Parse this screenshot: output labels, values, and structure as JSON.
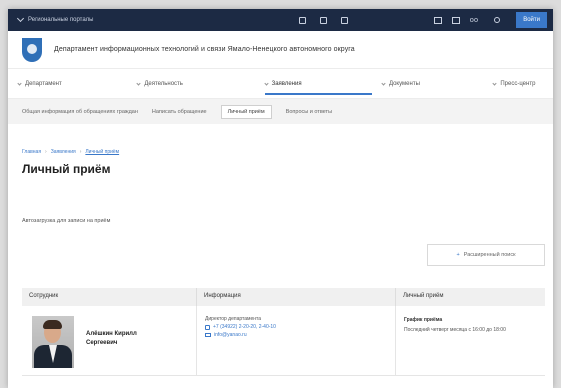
{
  "topbar": {
    "region_label": "Региональные порталы",
    "login_label": "Войти"
  },
  "header": {
    "title": "Департамент информационных технологий и связи Ямало-Ненецкого автономного округа"
  },
  "main_nav": [
    {
      "label": "Департамент"
    },
    {
      "label": "Деятельность"
    },
    {
      "label": "Заявления"
    },
    {
      "label": "Документы"
    },
    {
      "label": "Пресс-центр"
    }
  ],
  "sub_nav": [
    {
      "label": "Общая информация об обращениях граждан"
    },
    {
      "label": "Написать обращение"
    },
    {
      "label": "Личный приём"
    },
    {
      "label": "Вопросы и ответы"
    }
  ],
  "breadcrumb": {
    "home": "Главная",
    "section": "Заявления",
    "current": "Личный приём"
  },
  "page_title": "Личный приём",
  "auto_text": "Автозагрузка для записи на приём",
  "advanced_search": "Расширенный поиск",
  "table": {
    "headers": [
      "Сотрудник",
      "Информация",
      "Личный приём"
    ],
    "row": {
      "name_line1": "Алёшкин Кирилл",
      "name_line2": "Сергеевич",
      "info_role": "Директор департамента",
      "info_phone": "+7 (34922) 2-20-20, 2-40-10",
      "info_email": "info@yanao.ru",
      "reception_title": "График приёма",
      "reception_text": "Последний четверг месяца с 16:00 до 18:00"
    }
  }
}
